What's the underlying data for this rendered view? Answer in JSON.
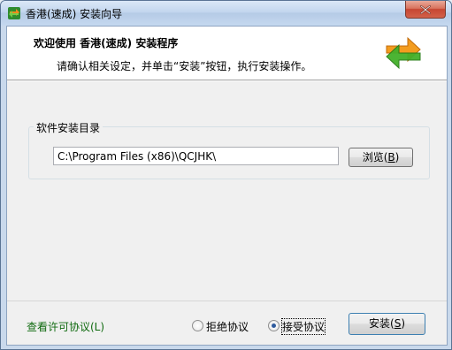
{
  "window": {
    "title": "香港(速成) 安装向导"
  },
  "header": {
    "welcome": "欢迎使用 香港(速成) 安装程序",
    "instruction": "请确认相关设定，并单击“安装”按钮，执行安装操作。"
  },
  "install_dir": {
    "group_label": "软件安装目录",
    "path": "C:\\Program Files (x86)\\QCJHK\\",
    "browse_label": "浏览",
    "browse_key": "B"
  },
  "footer": {
    "license_link": "查看许可协议(L)",
    "reject_label": "拒绝协议",
    "accept_label": "接受协议",
    "selected": "accept",
    "install_label": "安装",
    "install_key": "S"
  },
  "colors": {
    "link": "#0f6a0f",
    "title_bar": "#c3d6ee",
    "close_button": "#c64632"
  }
}
